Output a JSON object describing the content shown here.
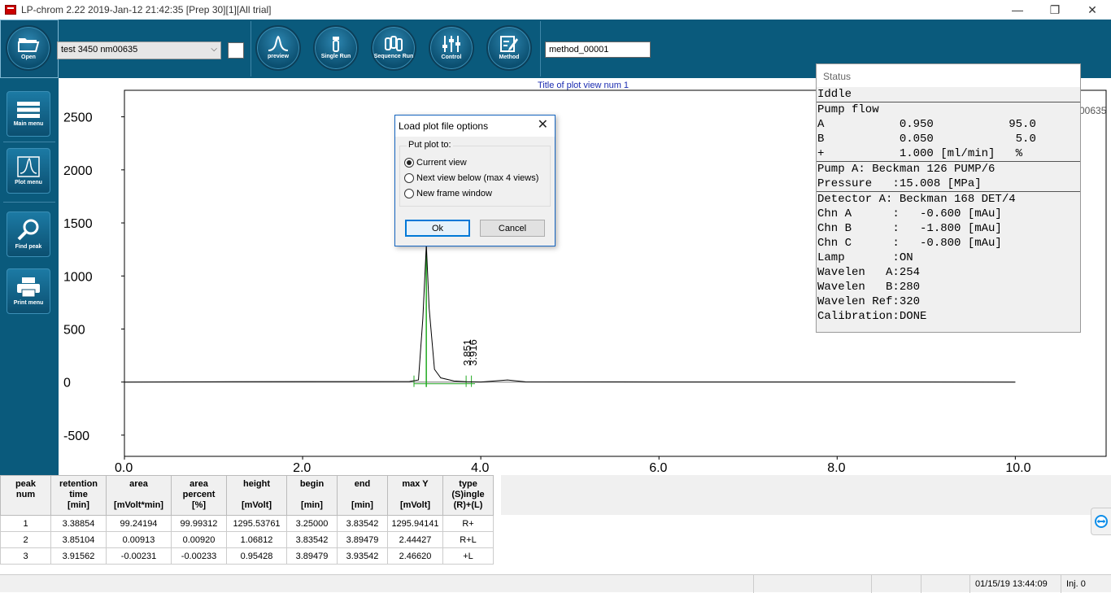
{
  "window": {
    "title": "LP-chrom 2.22 2019-Jan-12 21:42:35 [Prep 30][1][All trial]",
    "minimize": "—",
    "restore": "❐",
    "close": "✕"
  },
  "toolbar": {
    "open_label": "Open",
    "file_combo_value": "test 3450 nm00635",
    "preview_label": "preview",
    "single_run_label": "Single Run",
    "sequence_run_label": "Sequence Run",
    "control_label": "Control",
    "method_label": "Method",
    "method_value": "method_00001"
  },
  "sidebar": {
    "items": [
      {
        "label": "Main menu",
        "icon": "list-icon"
      },
      {
        "label": "Plot menu",
        "icon": "peak-icon"
      },
      {
        "label": "Find peak",
        "icon": "magnifier-icon"
      },
      {
        "label": "Print menu",
        "icon": "printer-icon"
      }
    ]
  },
  "plot": {
    "title": "Title of plot view num 1",
    "right_label": "00635",
    "peak_labels": [
      "3.851",
      "3.916"
    ]
  },
  "chart_data": {
    "type": "line",
    "title": "Title of plot view num 1",
    "xlabel": "",
    "ylabel": "",
    "xlim": [
      0,
      10
    ],
    "ylim": [
      -700,
      2750
    ],
    "x_ticks": [
      "0.0",
      "2.0",
      "4.0",
      "6.0",
      "8.0",
      "10.0"
    ],
    "y_ticks": [
      "2500",
      "2000",
      "1500",
      "1000",
      "500",
      "0",
      "-500"
    ],
    "series": [
      {
        "x": [
          0.0,
          1.2,
          3.2,
          3.3,
          3.35,
          3.38854,
          3.42,
          3.48,
          3.55,
          3.7,
          3.83542,
          3.89,
          4.0,
          4.3,
          4.5,
          6.0,
          8.0,
          10.0
        ],
        "y": [
          0,
          3,
          5,
          20,
          600,
          1295.5,
          700,
          120,
          40,
          10,
          3,
          2,
          1,
          20,
          2,
          1,
          1,
          0
        ]
      }
    ],
    "peaks": [
      {
        "num": 1,
        "retention": 3.38854,
        "begin": 3.25,
        "end": 3.83542,
        "height": 1295.53761
      },
      {
        "num": 2,
        "retention": 3.85104,
        "begin": 3.83542,
        "end": 3.89479,
        "height": 1.06812
      },
      {
        "num": 3,
        "retention": 3.91562,
        "begin": 3.89479,
        "end": 3.93542,
        "height": 0.95428
      }
    ],
    "colors": {
      "signal": "#000000",
      "baseline": "#22aa22"
    }
  },
  "dialog": {
    "title": "Load plot file options",
    "group_label": "Put plot to:",
    "options": [
      "Current view",
      "Next view below (max 4 views)",
      "New frame window"
    ],
    "selected": 0,
    "ok_label": "Ok",
    "cancel_label": "Cancel",
    "close": "✕"
  },
  "status": {
    "header": "Status",
    "lines": [
      "Iddle",
      "---",
      "Pump flow",
      "A           0.950           95.0",
      "B           0.050            5.0",
      "+           1.000 [ml/min]   %",
      "---",
      "Pump A: Beckman 126 PUMP/6",
      "Pressure   :15.008 [MPa]",
      "---",
      "Detector A: Beckman 168 DET/4",
      "Chn A      :   -0.600 [mAu]",
      "Chn B      :   -1.800 [mAu]",
      "Chn C      :   -0.800 [mAu]",
      "Lamp       :ON",
      "Wavelen   A:254",
      "Wavelen   B:280",
      "Wavelen Ref:320",
      "Calibration:DONE"
    ]
  },
  "table": {
    "headers": [
      [
        "peak",
        "num",
        ""
      ],
      [
        "retention",
        "time",
        "[min]"
      ],
      [
        "area",
        "",
        "[mVolt*min]"
      ],
      [
        "area",
        "percent",
        "[%]"
      ],
      [
        "height",
        "",
        "[mVolt]"
      ],
      [
        "begin",
        "",
        "[min]"
      ],
      [
        "end",
        "",
        "[min]"
      ],
      [
        "max Y",
        "",
        "[mVolt]"
      ],
      [
        "type",
        "(S)ingle",
        "(R)+(L)"
      ]
    ],
    "rows": [
      [
        "1",
        "3.38854",
        "99.24194",
        "99.99312",
        "1295.53761",
        "3.25000",
        "3.83542",
        "1295.94141",
        "R+"
      ],
      [
        "2",
        "3.85104",
        "0.00913",
        "0.00920",
        "1.06812",
        "3.83542",
        "3.89479",
        "2.44427",
        "R+L"
      ],
      [
        "3",
        "3.91562",
        "-0.00231",
        "-0.00233",
        "0.95428",
        "3.89479",
        "3.93542",
        "2.46620",
        "+L"
      ]
    ]
  },
  "statusbar": {
    "datetime": "01/15/19 13:44:09",
    "injection": "Inj. 0"
  }
}
